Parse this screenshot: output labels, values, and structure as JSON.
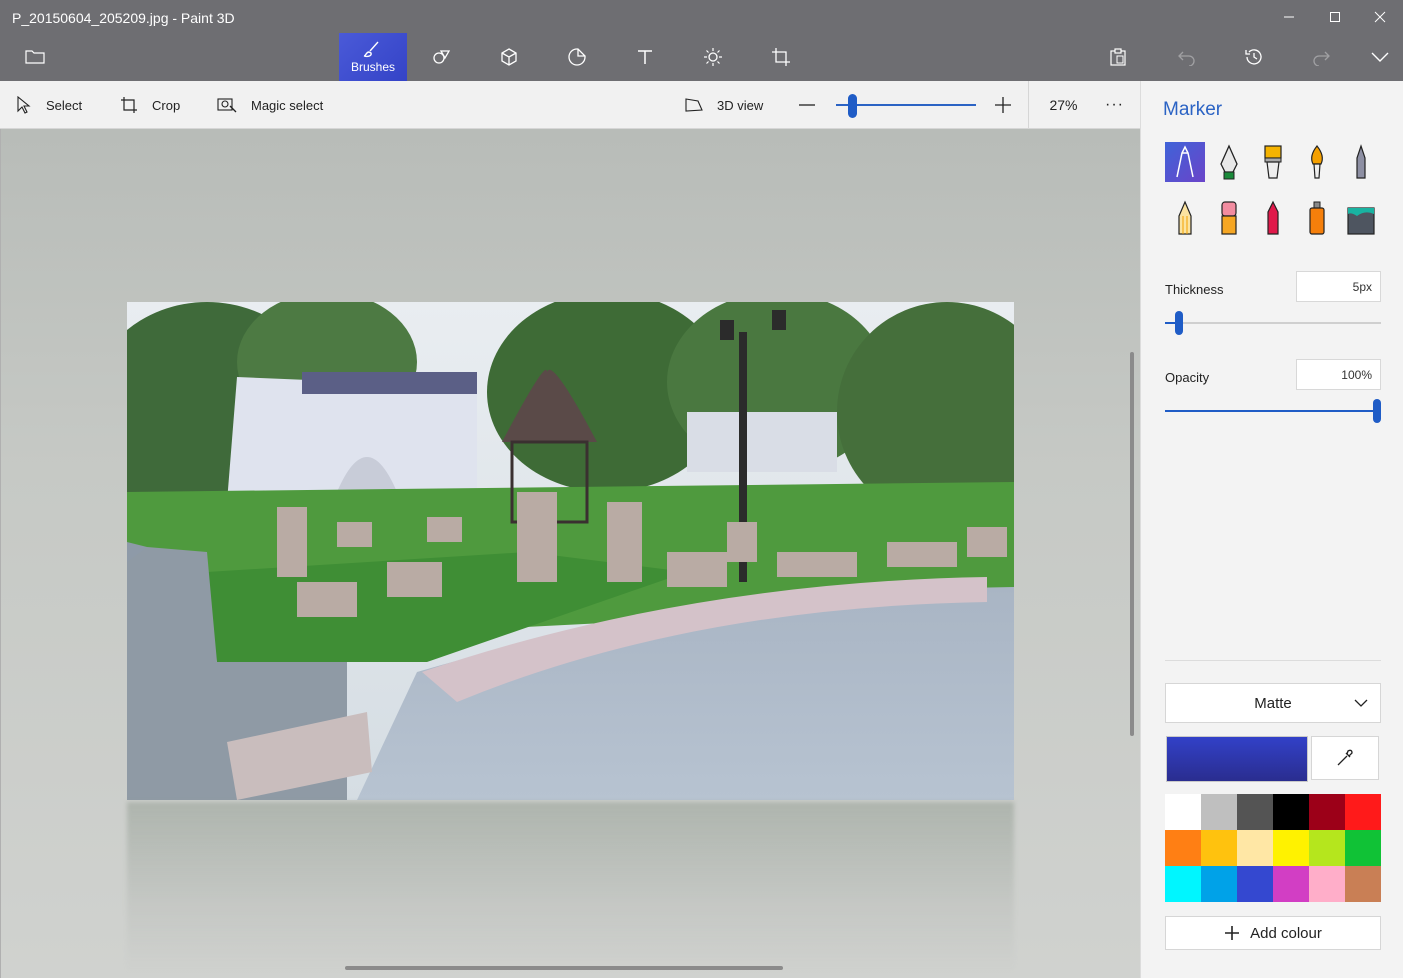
{
  "window": {
    "title": "P_20150604_205209.jpg - Paint 3D",
    "controls": [
      "minimize",
      "maximize",
      "close"
    ]
  },
  "toolbar": {
    "active_tab": "Brushes",
    "tabs": [
      {
        "name": "brushes",
        "label": "Brushes",
        "icon": "brush-icon"
      },
      {
        "name": "2d-shapes",
        "icon": "shapes-2d-icon"
      },
      {
        "name": "3d-shapes",
        "icon": "cube-icon"
      },
      {
        "name": "stickers",
        "icon": "sticker-icon"
      },
      {
        "name": "text",
        "icon": "text-icon"
      },
      {
        "name": "effects",
        "icon": "sun-icon"
      },
      {
        "name": "canvas",
        "icon": "canvas-icon"
      }
    ],
    "right": [
      {
        "name": "paste",
        "icon": "paste-icon"
      },
      {
        "name": "undo",
        "icon": "undo-icon",
        "enabled": false
      },
      {
        "name": "history",
        "icon": "history-icon"
      },
      {
        "name": "redo",
        "icon": "redo-icon",
        "enabled": false
      },
      {
        "name": "expand",
        "icon": "chevron-down-icon"
      }
    ]
  },
  "subbar": {
    "select_label": "Select",
    "crop_label": "Crop",
    "magic_select_label": "Magic select",
    "view3d_label": "3D view",
    "zoom_percent": "27%",
    "more_label": "···"
  },
  "canvas": {
    "image_description_icon": "photo-image"
  },
  "panel": {
    "title": "Marker",
    "brushes": [
      {
        "name": "marker",
        "selected": true
      },
      {
        "name": "calligraphy-pen"
      },
      {
        "name": "oil-brush"
      },
      {
        "name": "watercolor"
      },
      {
        "name": "pixel-pen"
      },
      {
        "name": "pencil"
      },
      {
        "name": "eraser"
      },
      {
        "name": "crayon"
      },
      {
        "name": "spray-can"
      },
      {
        "name": "fill"
      }
    ],
    "thickness_label": "Thickness",
    "thickness_value": "5px",
    "thickness_level": 0.05,
    "opacity_label": "Opacity",
    "opacity_value": "100%",
    "opacity_level": 1.0,
    "finish": "Matte",
    "current_color": "#3241c8",
    "palette": [
      "#ffffff",
      "#bfbfbf",
      "#545454",
      "#000000",
      "#9c0018",
      "#ff1a1a",
      "#ff7f14",
      "#ffc20e",
      "#ffe7a5",
      "#fff200",
      "#b5e61d",
      "#10c236",
      "#00f6ff",
      "#00a2e8",
      "#3448d0",
      "#d23ec4",
      "#ffaec9",
      "#c97f55"
    ],
    "add_colour_label": "Add colour"
  }
}
